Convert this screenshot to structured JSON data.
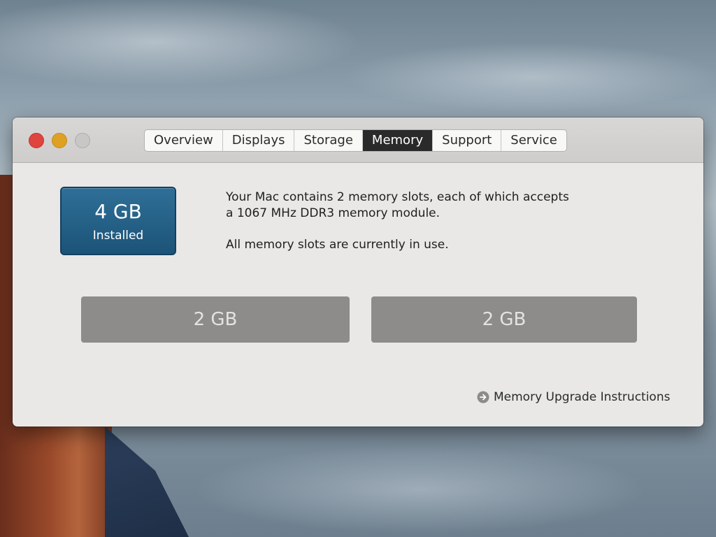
{
  "window": {
    "tabs": [
      {
        "label": "Overview",
        "active": false
      },
      {
        "label": "Displays",
        "active": false
      },
      {
        "label": "Storage",
        "active": false
      },
      {
        "label": "Memory",
        "active": true
      },
      {
        "label": "Support",
        "active": false
      },
      {
        "label": "Service",
        "active": false
      }
    ],
    "traffic_lights": {
      "close_color": "#e0443e",
      "minimize_color": "#dea123",
      "zoom_color": "#c9c7c5"
    }
  },
  "memory": {
    "installed": {
      "size": "4 GB",
      "label": "Installed",
      "tile_color": "#1c5378"
    },
    "description": {
      "line1": "Your Mac contains 2 memory slots, each of which accepts",
      "line2": "a 1067 MHz DDR3 memory module.",
      "line3": "All memory slots are currently in use."
    },
    "slots": [
      {
        "size": "2 GB"
      },
      {
        "size": "2 GB"
      }
    ],
    "upgrade_link": {
      "label": "Memory Upgrade Instructions",
      "icon": "arrow-right-circle-icon"
    }
  }
}
